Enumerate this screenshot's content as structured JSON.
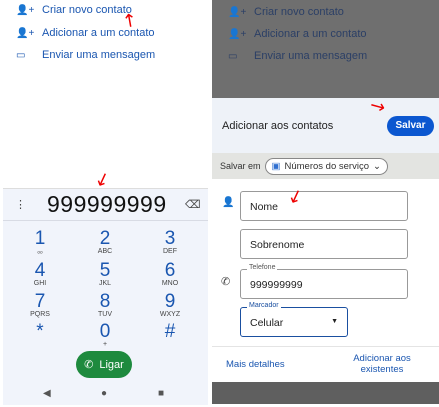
{
  "menu": {
    "items": [
      {
        "icon": "person-add-icon",
        "label": "Criar novo contato"
      },
      {
        "icon": "person-add-icon",
        "label": "Adicionar a um contato"
      },
      {
        "icon": "message-icon",
        "label": "Enviar uma mensagem"
      }
    ]
  },
  "dialer": {
    "number": "999999999",
    "keys": [
      {
        "d": "1",
        "l": "ₒₒ"
      },
      {
        "d": "2",
        "l": "ABC"
      },
      {
        "d": "3",
        "l": "DEF"
      },
      {
        "d": "4",
        "l": "GHI"
      },
      {
        "d": "5",
        "l": "JKL"
      },
      {
        "d": "6",
        "l": "MNO"
      },
      {
        "d": "7",
        "l": "PQRS"
      },
      {
        "d": "8",
        "l": "TUV"
      },
      {
        "d": "9",
        "l": "WXYZ"
      },
      {
        "d": "*",
        "l": ""
      },
      {
        "d": "0",
        "l": "+"
      },
      {
        "d": "#",
        "l": ""
      }
    ],
    "call_label": "Ligar"
  },
  "form": {
    "title": "Adicionar aos contatos",
    "save_label": "Salvar",
    "save_in_label": "Salvar em",
    "account": "Números do serviço",
    "first_name_placeholder": "Nome",
    "last_name_placeholder": "Sobrenome",
    "phone_label": "Telefone",
    "phone_value": "999999999",
    "tag_label": "Marcador",
    "tag_value": "Celular",
    "more_details": "Mais detalhes",
    "add_existing": "Adicionar aos existentes"
  },
  "colors": {
    "accent": "#1a56b0",
    "call": "#1e8a3e"
  }
}
